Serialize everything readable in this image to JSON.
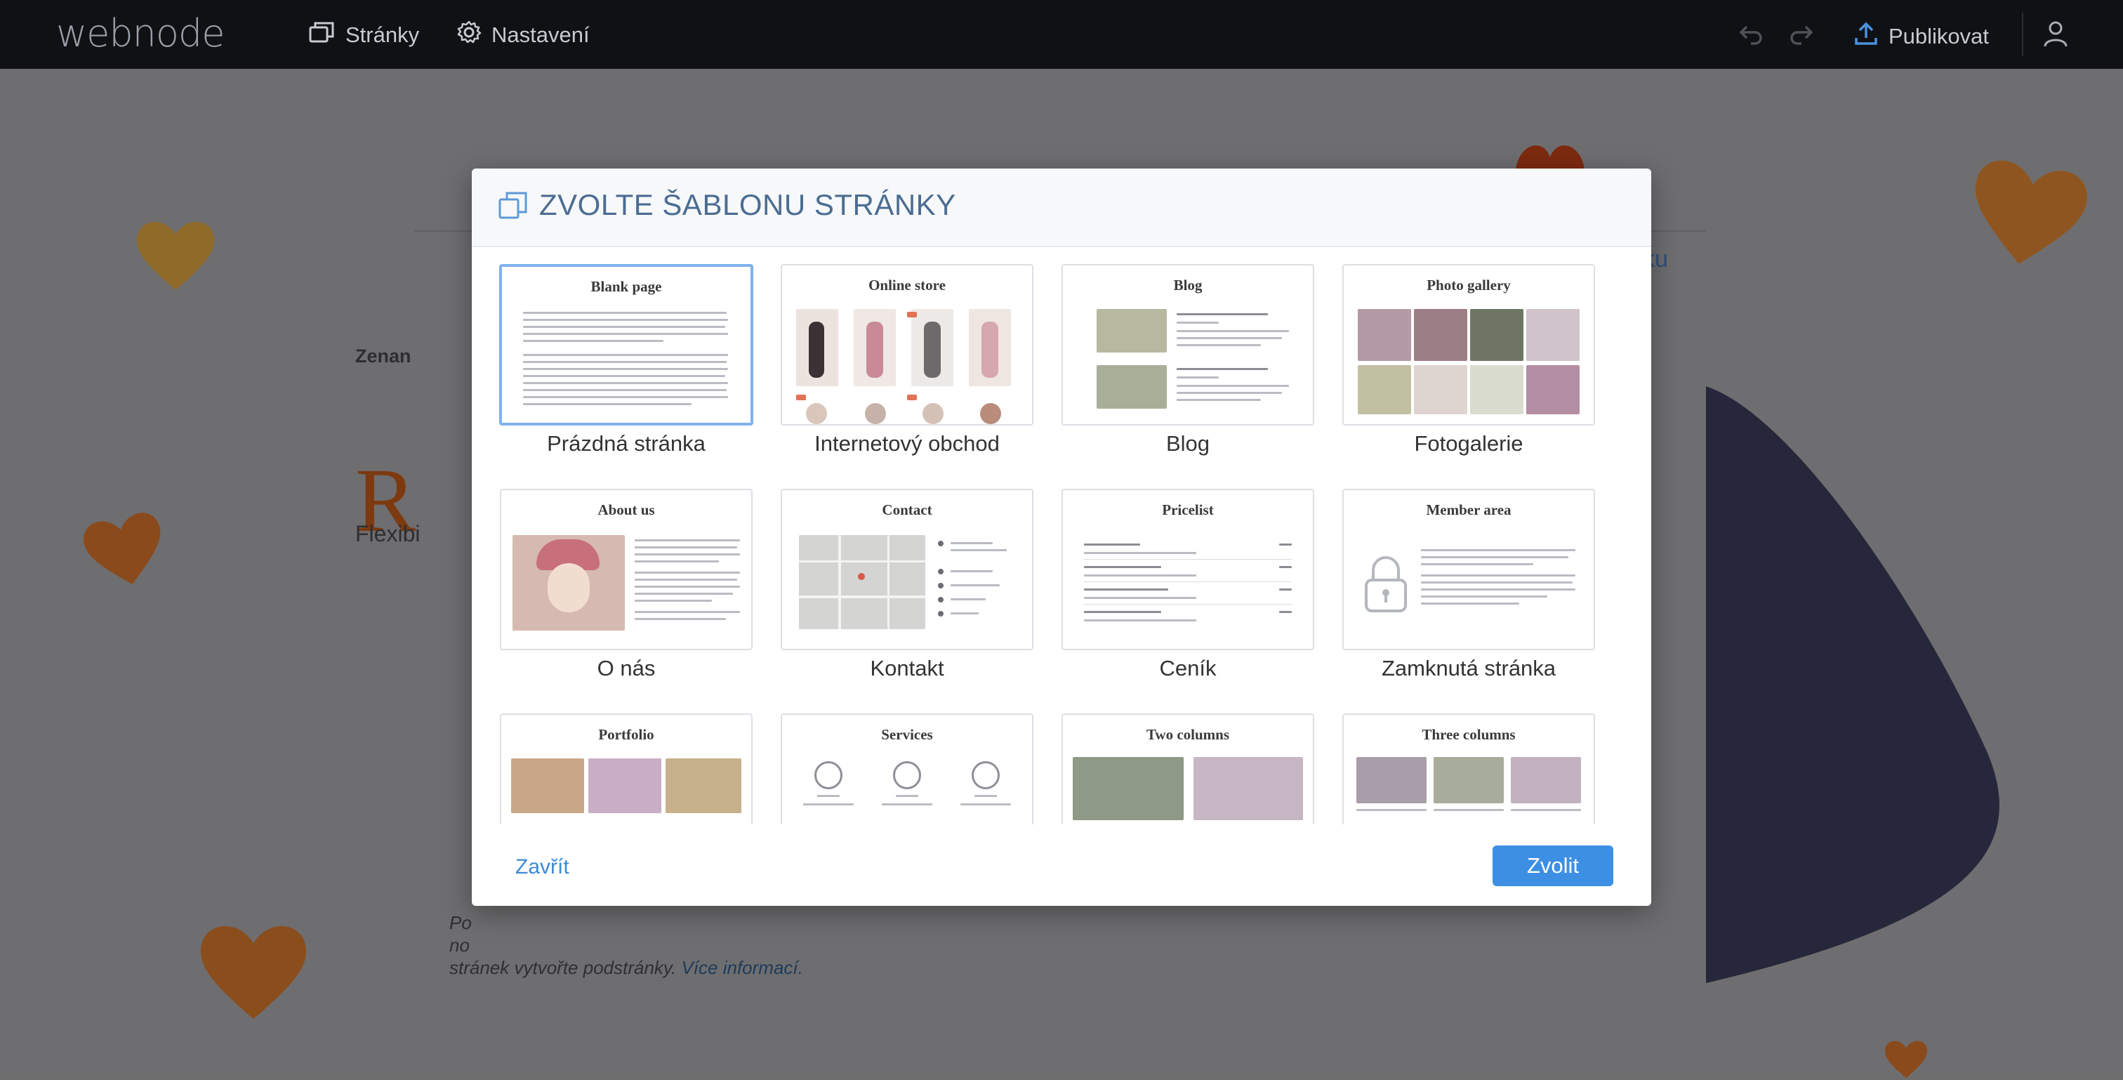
{
  "app": {
    "logo": "webnode",
    "nav": [
      {
        "label": "Stránky",
        "icon": "pages-icon"
      },
      {
        "label": "Nastavení",
        "icon": "gear-icon"
      }
    ],
    "publish_label": "Publikovat"
  },
  "background": {
    "heading_small": "Zenan",
    "heading_big": "R",
    "body_text": "Flexibi",
    "tab_right": "ku",
    "footer_text": "Po\nno\nstránek vytvořte podstránky.",
    "footer_link": "Více informací."
  },
  "modal": {
    "title": "ZVOLTE ŠABLONU STRÁNKY",
    "templates": [
      {
        "thumb_title": "Blank page",
        "label": "Prázdná stránka"
      },
      {
        "thumb_title": "Online store",
        "label": "Internetový obchod"
      },
      {
        "thumb_title": "Blog",
        "label": "Blog"
      },
      {
        "thumb_title": "Photo gallery",
        "label": "Fotogalerie"
      },
      {
        "thumb_title": "About us",
        "label": "O nás"
      },
      {
        "thumb_title": "Contact",
        "label": "Kontakt"
      },
      {
        "thumb_title": "Pricelist",
        "label": "Ceník"
      },
      {
        "thumb_title": "Member area",
        "label": "Zamknutá stránka"
      },
      {
        "thumb_title": "Portfolio",
        "label": ""
      },
      {
        "thumb_title": "Services",
        "label": ""
      },
      {
        "thumb_title": "Two columns",
        "label": ""
      },
      {
        "thumb_title": "Three columns",
        "label": ""
      }
    ],
    "selected_index": 0,
    "close_label": "Zavřít",
    "choose_label": "Zvolit"
  },
  "colors": {
    "accent": "#3d8fe4",
    "topbar": "#0f1114",
    "title": "#4b6d92",
    "selected_border": "#7fb2f0"
  }
}
